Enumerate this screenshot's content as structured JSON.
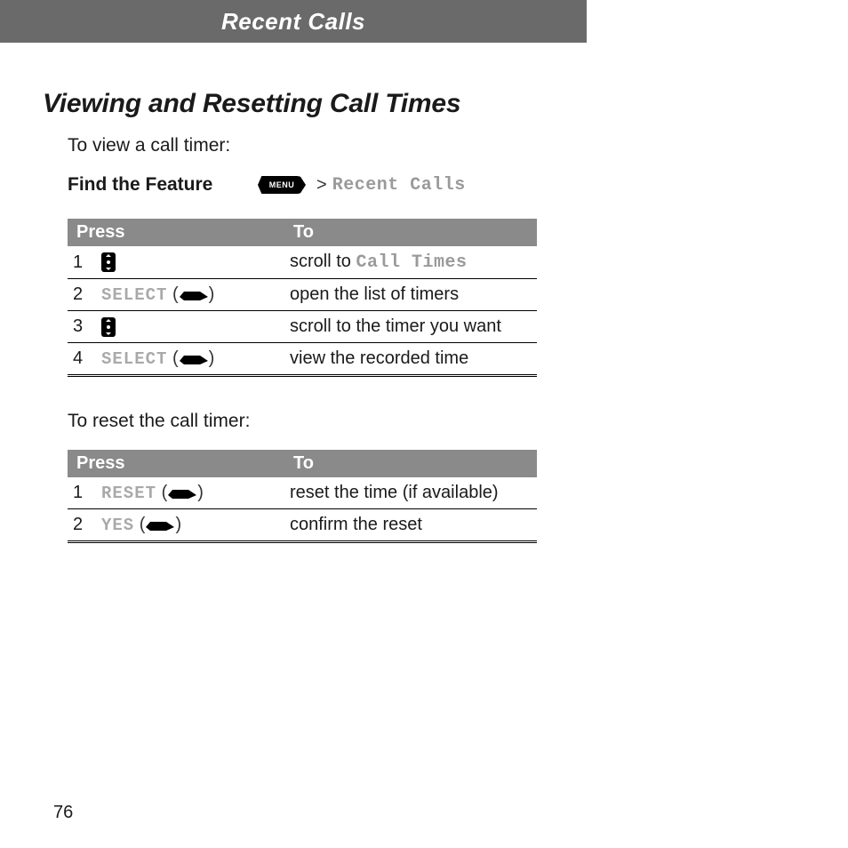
{
  "header": "Recent Calls",
  "section_title": "Viewing and Resetting Call Times",
  "intro1": "To view a call timer:",
  "feature_label": "Find the Feature",
  "menu_key": "MENU",
  "gt": ">",
  "breadcrumb": "Recent Calls",
  "table1": {
    "head_press": "Press",
    "head_to": "To",
    "rows": [
      {
        "n": "1",
        "press_type": "nav",
        "softkey": "",
        "to_pre": "scroll to ",
        "to_mono": "Call Times",
        "to_post": ""
      },
      {
        "n": "2",
        "press_type": "soft",
        "softkey": "SELECT",
        "to_pre": "open the list of timers",
        "to_mono": "",
        "to_post": ""
      },
      {
        "n": "3",
        "press_type": "nav",
        "softkey": "",
        "to_pre": "scroll to the timer you want",
        "to_mono": "",
        "to_post": ""
      },
      {
        "n": "4",
        "press_type": "soft",
        "softkey": "SELECT",
        "to_pre": "view the recorded time",
        "to_mono": "",
        "to_post": ""
      }
    ]
  },
  "intro2": "To reset the call timer:",
  "table2": {
    "head_press": "Press",
    "head_to": "To",
    "rows": [
      {
        "n": "1",
        "press_type": "soft",
        "softkey": "RESET",
        "to_pre": "reset the time (if available)",
        "to_mono": "",
        "to_post": ""
      },
      {
        "n": "2",
        "press_type": "soft",
        "softkey": "YES",
        "to_pre": "confirm the reset",
        "to_mono": "",
        "to_post": ""
      }
    ]
  },
  "page_number": "76"
}
